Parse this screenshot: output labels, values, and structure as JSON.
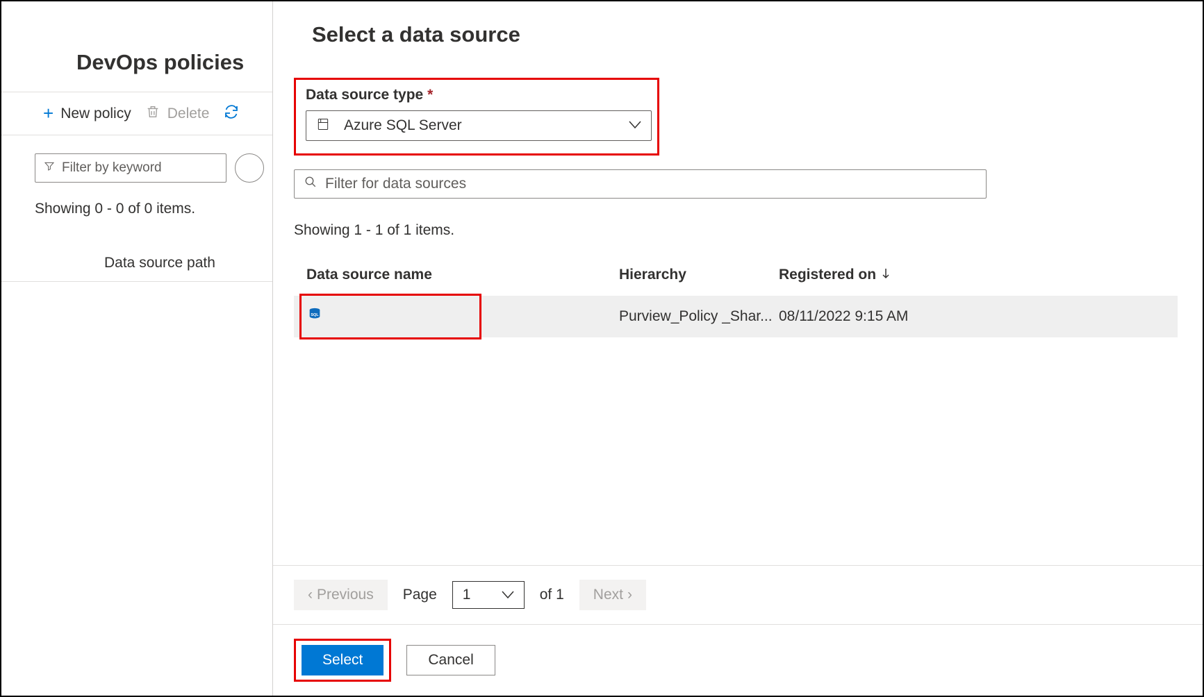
{
  "left": {
    "title": "DevOps policies",
    "new_policy": "New policy",
    "delete": "Delete",
    "filter_placeholder": "Filter by keyword",
    "showing": "Showing 0 - 0 of 0 items.",
    "col_path": "Data source path"
  },
  "panel": {
    "title": "Select a data source",
    "field_label": "Data source type",
    "dropdown_value": "Azure SQL Server",
    "search_placeholder": "Filter for data sources",
    "showing": "Showing 1 - 1 of 1 items.",
    "columns": {
      "name": "Data source name",
      "hierarchy": "Hierarchy",
      "registered": "Registered on"
    },
    "rows": [
      {
        "name": "",
        "hierarchy": "Purview_Policy _Shar...",
        "registered": "08/11/2022 9:15 AM"
      }
    ],
    "pager": {
      "prev": "Previous",
      "page_label": "Page",
      "page_value": "1",
      "of_label": "of 1",
      "next": "Next"
    },
    "footer": {
      "select": "Select",
      "cancel": "Cancel"
    }
  }
}
